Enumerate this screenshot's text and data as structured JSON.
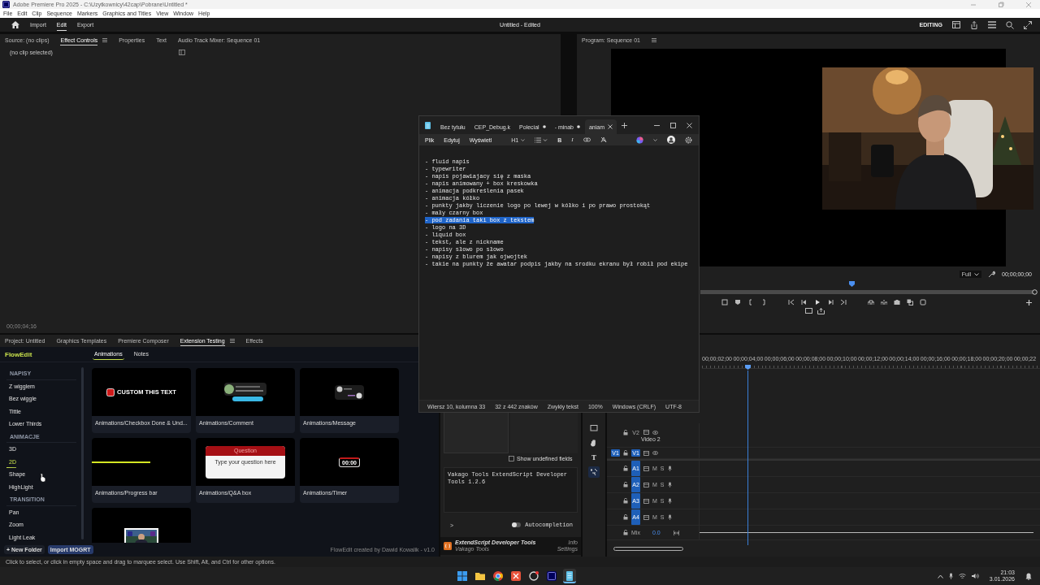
{
  "app_window": {
    "title": "Adobe Premiere Pro 2025 - C:\\Uzytkownicy\\42cap\\Pobrane\\Untitled *"
  },
  "menu": [
    "File",
    "Edit",
    "Clip",
    "Sequence",
    "Markers",
    "Graphics and Titles",
    "View",
    "Window",
    "Help"
  ],
  "workspace": {
    "tabs": [
      {
        "label": "Import",
        "selected": false
      },
      {
        "label": "Edit",
        "selected": true
      },
      {
        "label": "Export",
        "selected": false
      }
    ],
    "document_title": "Untitled - Edited",
    "mode": "EDITING"
  },
  "source_panel": {
    "tabs": [
      {
        "label": "Source: (no clips)",
        "selected": false
      },
      {
        "label": "Effect Controls",
        "selected": true
      },
      {
        "label": "Properties",
        "selected": false
      },
      {
        "label": "Text",
        "selected": false
      },
      {
        "label": "Audio Track Mixer: Sequence 01",
        "selected": false
      }
    ],
    "message": "(no clip selected)",
    "timecode": "00;00;04;16"
  },
  "program_monitor": {
    "title": "Program: Sequence 01",
    "fit": "Full",
    "timecode": "00;00;00;00"
  },
  "project_panel": {
    "tabs": [
      {
        "label": "Project: Untitled",
        "selected": false
      },
      {
        "label": "Graphics Templates",
        "selected": false
      },
      {
        "label": "Premiere Composer",
        "selected": false
      },
      {
        "label": "Extension Testing",
        "selected": true
      },
      {
        "label": "Effects",
        "selected": false
      }
    ]
  },
  "flowedit": {
    "logo": "FlowEdit",
    "tabs": [
      {
        "label": "Animations",
        "selected": true
      },
      {
        "label": "Notes",
        "selected": false
      }
    ],
    "sidebar": [
      {
        "kind": "heading",
        "label": "NAPISY"
      },
      {
        "kind": "item",
        "label": "Z wigglem",
        "selected": false
      },
      {
        "kind": "item",
        "label": "Bez wiggle",
        "selected": false
      },
      {
        "kind": "item",
        "label": "Tittle",
        "selected": false
      },
      {
        "kind": "item",
        "label": "Lower Thirds",
        "selected": false
      },
      {
        "kind": "heading",
        "label": "ANIMACJE"
      },
      {
        "kind": "item",
        "label": "3D",
        "selected": false
      },
      {
        "kind": "item",
        "label": "2D",
        "selected": true
      },
      {
        "kind": "item",
        "label": "Shape",
        "selected": false
      },
      {
        "kind": "item",
        "label": "HighLight",
        "selected": false
      },
      {
        "kind": "heading",
        "label": "TRANSITION"
      },
      {
        "kind": "item",
        "label": "Pan",
        "selected": false
      },
      {
        "kind": "item",
        "label": "Zoom",
        "selected": false
      },
      {
        "kind": "item",
        "label": "Light Leak",
        "selected": false
      }
    ],
    "cards": [
      {
        "kind": "checkbox",
        "preview_text": "CUSTOM THIS TEXT",
        "title": "Animations/Checkbox Done & Und..."
      },
      {
        "kind": "comment",
        "title": "Animations/Comment"
      },
      {
        "kind": "message",
        "title": "Animations/Message"
      },
      {
        "kind": "progress",
        "title": "Animations/Progress bar"
      },
      {
        "kind": "qa",
        "question": "Question",
        "hint": "Type your question here",
        "title": "Animations/Q&A box"
      },
      {
        "kind": "timer",
        "preview_text": "00:00",
        "title": "Animations/Timer"
      },
      {
        "kind": "thumbnail"
      }
    ],
    "buttons": [
      "+ New Folder",
      "Import MOGRT"
    ],
    "credit": "FlowEdit created by Dawid Kowalik - v1.0"
  },
  "extendscript": {
    "show_undefined": {
      "label": "Show undefined fields",
      "checked": false
    },
    "output": "Vakago Tools ExtendScript Developer Tools 1.2.6",
    "prompt": ">",
    "autocompletion": {
      "label": "Autocompletion",
      "on": false
    },
    "footer_title": "ExtendScript Developer Tools",
    "footer_vendor": "Vakago Tools",
    "links": [
      "Info",
      "Settings"
    ]
  },
  "tools": [
    {
      "kind": "rectangle",
      "selected": false
    },
    {
      "kind": "hand",
      "selected": false
    },
    {
      "kind": "type",
      "label": "T",
      "selected": false
    },
    {
      "kind": "track-select",
      "selected": true
    }
  ],
  "timeline": {
    "ruler": [
      "00;00;02;00",
      "00;00;04;00",
      "00;00;06;00",
      "00;00;08;00",
      "00;00;10;00",
      "00;00;12;00",
      "00;00;14;00",
      "00;00;16;00",
      "00;00;18;00",
      "00;00;20;00",
      "00;00;22"
    ],
    "tracks": [
      {
        "kind": "video",
        "label": "V2",
        "name": "Video 2",
        "targeted": false
      },
      {
        "kind": "video",
        "label": "V1",
        "source": "V1",
        "targeted": true
      },
      {
        "kind": "audio",
        "label": "A1",
        "mute": "M",
        "solo": "S",
        "targeted": true
      },
      {
        "kind": "audio",
        "label": "A2",
        "mute": "M",
        "solo": "S",
        "targeted": true
      },
      {
        "kind": "audio",
        "label": "A3",
        "mute": "M",
        "solo": "S",
        "targeted": true
      },
      {
        "kind": "audio",
        "label": "A4",
        "mute": "M",
        "solo": "S",
        "targeted": true
      },
      {
        "kind": "mix",
        "label": "Mix",
        "value": "0.0"
      }
    ]
  },
  "notepad": {
    "tabs": [
      {
        "label": "Bez tytułu",
        "modified": false,
        "selected": false
      },
      {
        "label": "CEP_Debug.k",
        "modified": false,
        "selected": false
      },
      {
        "label": "Polecial",
        "modified": true,
        "selected": false
      },
      {
        "label": "- minab",
        "modified": true,
        "selected": false
      },
      {
        "label": "aniam",
        "modified": false,
        "selected": true
      }
    ],
    "menu": [
      "Plik",
      "Edytuj",
      "Wyświetl"
    ],
    "heading": "H1",
    "bold": "B",
    "italic": "I",
    "lines": [
      {
        "text": "- fluid napis",
        "selected": false
      },
      {
        "text": "- typewriter",
        "selected": false
      },
      {
        "text": "- napis pojawiajacy się z maska",
        "selected": false
      },
      {
        "text": "- napis animowany + box kreskowka",
        "selected": false
      },
      {
        "text": "- animacja podkreślenia pasek",
        "selected": false
      },
      {
        "text": "- animacja kółko",
        "selected": false
      },
      {
        "text": "- punkty jakby liczenie logo po lewej w kółko i po prawo prostokąt",
        "selected": false
      },
      {
        "text": "- mały czarny box",
        "selected": false
      },
      {
        "text": "- pod zadania taki box z tekstem",
        "selected": true
      },
      {
        "text": "- logo na 3D",
        "selected": false
      },
      {
        "text": "- liquid box",
        "selected": false
      },
      {
        "text": "- tekst, ale z nickname",
        "selected": false
      },
      {
        "text": "- napisy słowo po słowo",
        "selected": false
      },
      {
        "text": "- napisy z blurem jak ojwojtek",
        "selected": false
      },
      {
        "text": "- takie na punkty że awatar podpis jakby na srodku ekranu był robił pod ekipe",
        "selected": false
      }
    ],
    "status": [
      "Wiersz 10, kolumna 33",
      "32 z 442 znaków",
      "Zwykły tekst",
      "100%",
      "Windows (CRLF)",
      "UTF-8"
    ]
  },
  "status_bar": "Click to select, or click in empty space and drag to marquee select. Use Shift, Alt, and Ctrl for other options.",
  "taskbar": {
    "apps": [
      {
        "kind": "windows",
        "active": false
      },
      {
        "kind": "folder",
        "active": false
      },
      {
        "kind": "chrome",
        "active": false
      },
      {
        "kind": "red-app",
        "active": false
      },
      {
        "kind": "circle-app",
        "active": false
      },
      {
        "kind": "premiere",
        "active": false
      },
      {
        "kind": "notepad",
        "active": true
      }
    ],
    "time": "21:03",
    "date": "3.01.2026"
  }
}
